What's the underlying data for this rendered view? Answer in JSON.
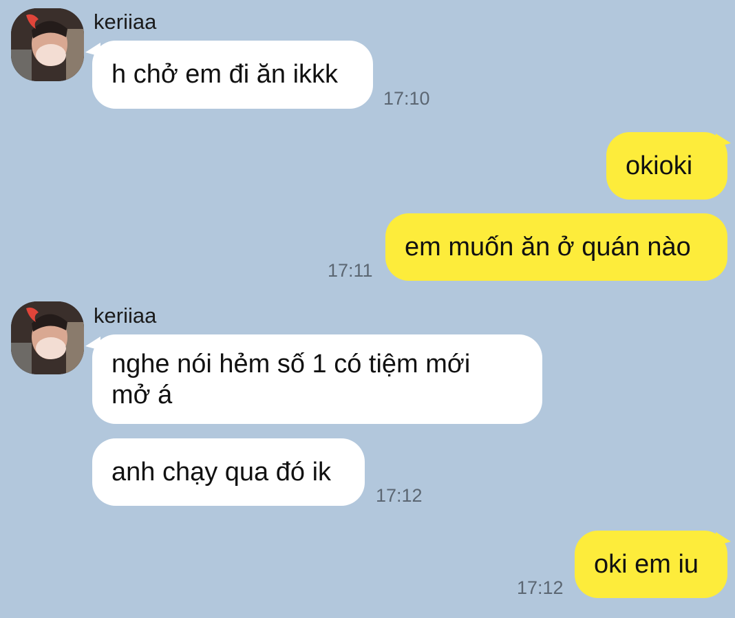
{
  "chat": {
    "contact_name": "keriiaa",
    "messages": [
      {
        "from": "contact",
        "text": "h chở em đi ăn ikkk",
        "time": "17:10"
      },
      {
        "from": "me",
        "text": "okioki",
        "time": ""
      },
      {
        "from": "me",
        "text": "em muốn ăn ở quán nào",
        "time": "17:11"
      },
      {
        "from": "contact",
        "text": "nghe nói hẻm số 1 có tiệm mới mở á",
        "time": ""
      },
      {
        "from": "contact",
        "text": "anh chạy qua đó ik",
        "time": "17:12"
      },
      {
        "from": "me",
        "text": "oki em iu",
        "time": "17:12"
      }
    ]
  },
  "colors": {
    "background": "#b2c7dc",
    "incoming_bubble": "#ffffff",
    "outgoing_bubble": "#fdec3b",
    "timestamp": "#5b6672"
  }
}
